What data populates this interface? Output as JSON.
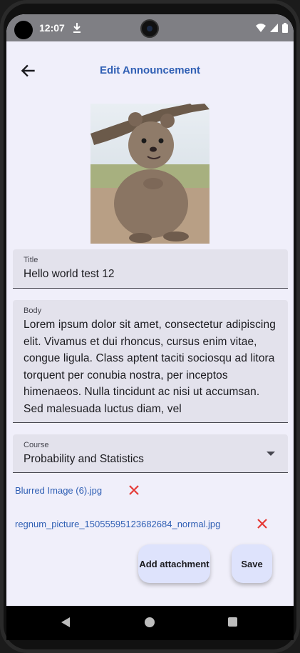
{
  "status_bar": {
    "time": "12:07"
  },
  "app_bar": {
    "title": "Edit Announcement"
  },
  "form": {
    "title_label": "Title",
    "title_value": "Hello world test 12",
    "body_label": "Body",
    "body_value": "Lorem ipsum dolor sit amet, consectetur adipiscing elit. Vivamus et dui rhoncus, cursus enim vitae, congue ligula. Class aptent taciti sociosqu ad litora torquent per conubia nostra, per inceptos himenaeos. Nulla tincidunt ac nisi ut accumsan. Sed malesuada luctus diam, vel",
    "course_label": "Course",
    "course_value": "Probability and Statistics"
  },
  "attachments": [
    {
      "name": "Blurred Image (6).jpg"
    },
    {
      "name": "regnum_picture_15055595123682684_normal.jpg"
    }
  ],
  "actions": {
    "add_attachment_label": "Add attachment",
    "save_label": "Save"
  },
  "colors": {
    "accent": "#2f5fb4",
    "remove": "#e53935",
    "button_bg": "#dee3fc",
    "field_bg": "#e3e2ec"
  }
}
